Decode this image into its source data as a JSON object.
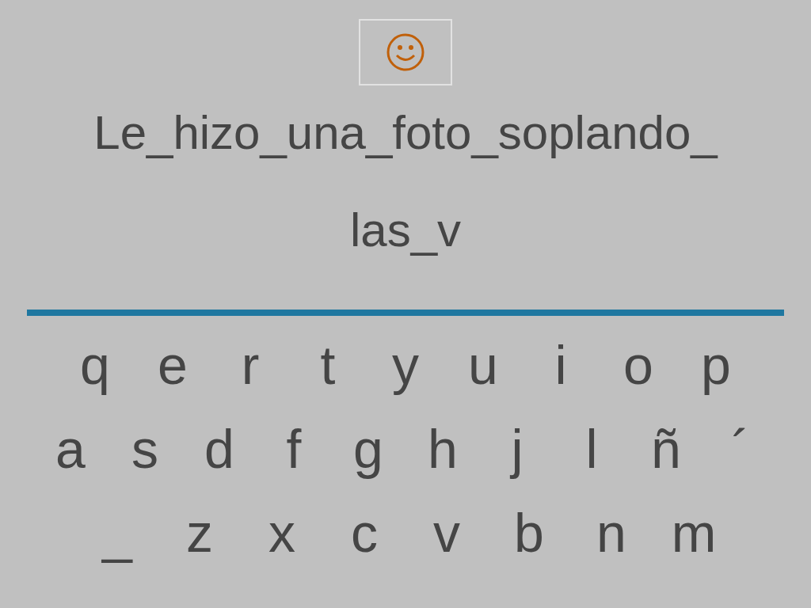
{
  "feedback": {
    "kind": "smiley"
  },
  "sentence": {
    "lines": [
      "Le_hizo_una_foto_soplando_",
      "las_v"
    ]
  },
  "keyboard": {
    "rows": [
      [
        "q",
        "e",
        "r",
        "t",
        "y",
        "u",
        "i",
        "o",
        "p"
      ],
      [
        "a",
        "s",
        "d",
        "f",
        "g",
        "h",
        "j",
        "l",
        "ñ",
        "´"
      ],
      [
        "_",
        "z",
        "x",
        "c",
        "v",
        "b",
        "n",
        "m"
      ]
    ]
  }
}
